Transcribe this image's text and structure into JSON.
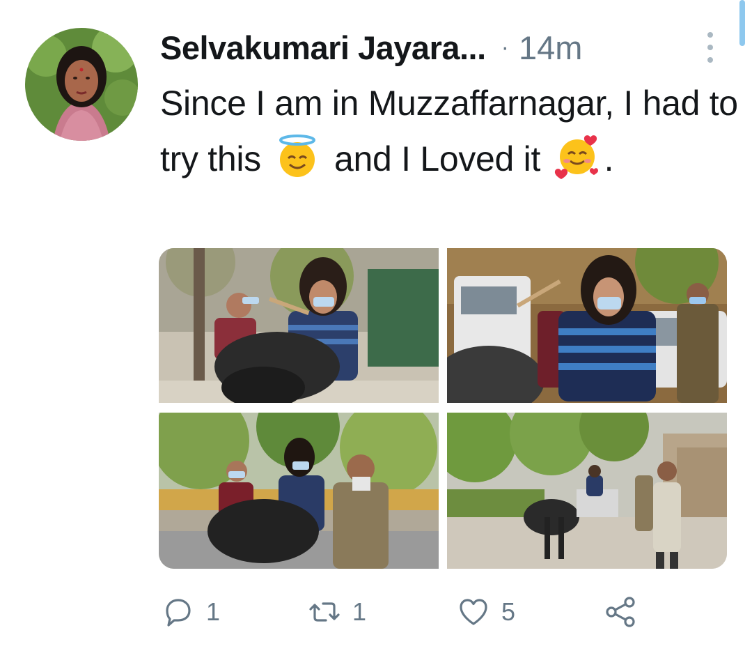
{
  "tweet": {
    "author_name": "Selvakumari Jayara...",
    "separator": "·",
    "time": "14m",
    "text": {
      "part1": "Since I am in Muzzaffarnagar, I had to try this",
      "part2": "and I Loved it",
      "part3": "."
    },
    "emojis": [
      "smiling-face-with-halo-emoji",
      "smiling-face-with-hearts-emoji"
    ],
    "photos": [
      "photo-woman-riding-buffalo-cart-1",
      "photo-woman-riding-buffalo-cart-2",
      "photo-woman-riding-buffalo-cart-3",
      "photo-woman-riding-buffalo-cart-4"
    ]
  },
  "actions": {
    "reply_count": "1",
    "retweet_count": "1",
    "like_count": "5"
  },
  "colors": {
    "text": "#14171a",
    "muted": "#657786",
    "accent": "#1da1f2"
  },
  "icons": [
    "more-options-icon",
    "reply-icon",
    "retweet-icon",
    "like-icon",
    "share-icon"
  ]
}
